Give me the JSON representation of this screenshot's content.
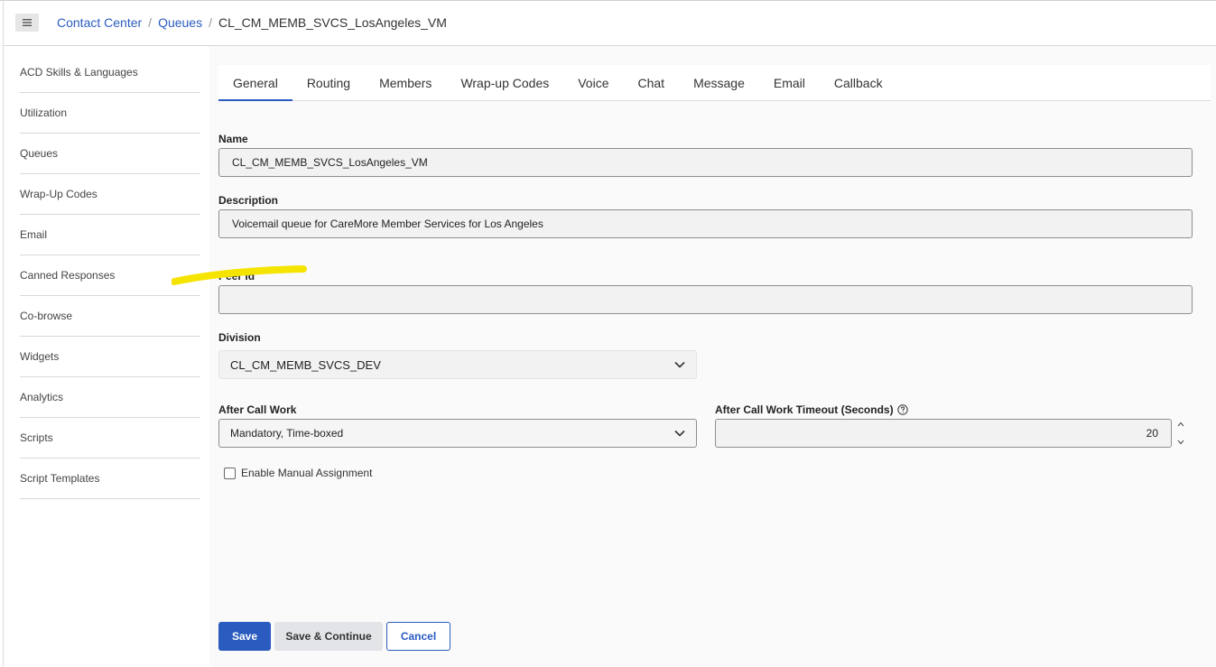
{
  "breadcrumb": {
    "items": [
      "Contact Center",
      "Queues"
    ],
    "current": "CL_CM_MEMB_SVCS_LosAngeles_VM",
    "separator": "/"
  },
  "sidebar": {
    "items": [
      {
        "label": "ACD Skills & Languages"
      },
      {
        "label": "Utilization"
      },
      {
        "label": "Queues"
      },
      {
        "label": "Wrap-Up Codes"
      },
      {
        "label": "Email"
      },
      {
        "label": "Canned Responses"
      },
      {
        "label": "Co-browse"
      },
      {
        "label": "Widgets"
      },
      {
        "label": "Analytics"
      },
      {
        "label": "Scripts"
      },
      {
        "label": "Script Templates"
      }
    ]
  },
  "tabs": [
    {
      "label": "General",
      "active": true
    },
    {
      "label": "Routing"
    },
    {
      "label": "Members"
    },
    {
      "label": "Wrap-up Codes"
    },
    {
      "label": "Voice"
    },
    {
      "label": "Chat"
    },
    {
      "label": "Message"
    },
    {
      "label": "Email"
    },
    {
      "label": "Callback"
    }
  ],
  "form": {
    "name": {
      "label": "Name",
      "value": "CL_CM_MEMB_SVCS_LosAngeles_VM"
    },
    "description": {
      "label": "Description",
      "value": "Voicemail queue for CareMore Member Services for Los Angeles"
    },
    "peer_id": {
      "label": "Peer Id",
      "value": ""
    },
    "division": {
      "label": "Division",
      "value": "CL_CM_MEMB_SVCS_DEV"
    },
    "after_call_work": {
      "label": "After Call Work",
      "value": "Mandatory, Time-boxed"
    },
    "acw_timeout": {
      "label": "After Call Work Timeout (Seconds)",
      "value": "20"
    },
    "manual_assignment": {
      "label": "Enable Manual Assignment",
      "checked": false
    }
  },
  "actions": {
    "save": "Save",
    "save_continue": "Save & Continue",
    "cancel": "Cancel"
  },
  "colors": {
    "accent": "#2a5cc0",
    "highlight": "#f5e400"
  }
}
